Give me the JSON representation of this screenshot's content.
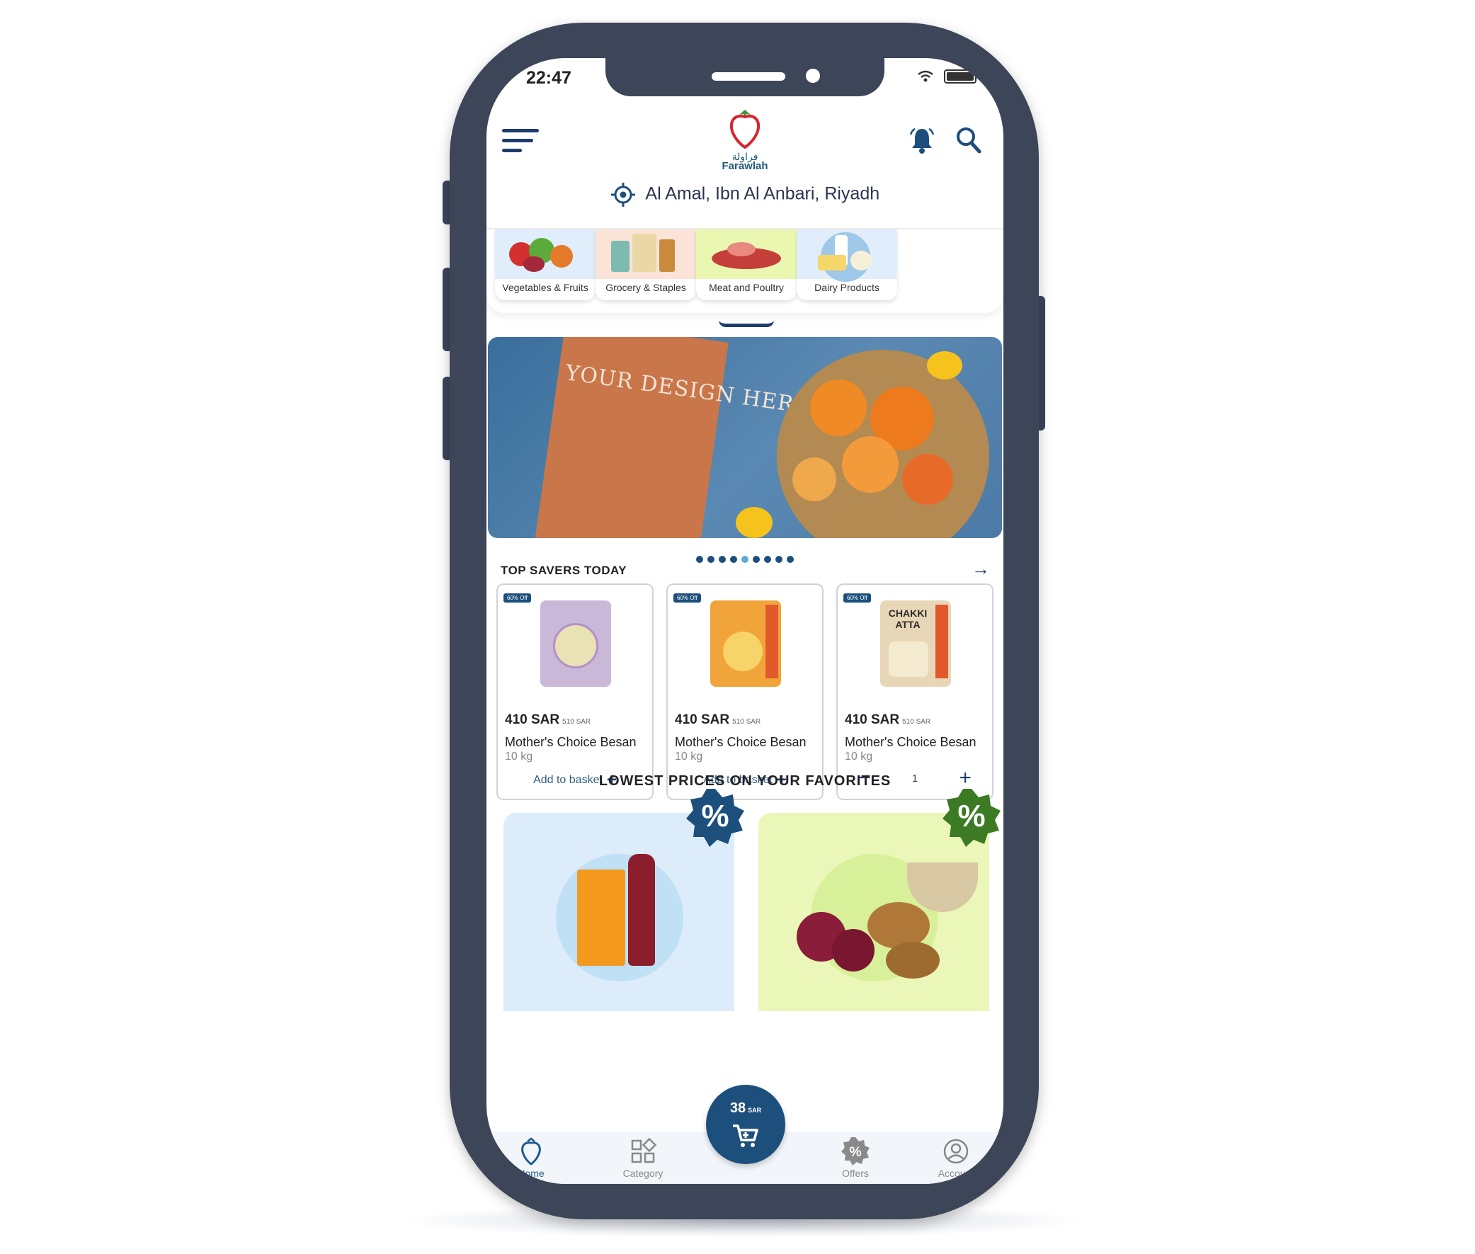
{
  "status_bar": {
    "time": "22:47",
    "icons": [
      "wifi-icon",
      "battery-icon"
    ]
  },
  "header": {
    "logo": {
      "arabic": "فراولة",
      "brand": "Farawlah"
    },
    "menu_icon": "hamburger-menu-icon",
    "bell_icon": "bell-icon",
    "search_icon": "search-icon",
    "location": "Al Amal, Ibn Al Anbari, Riyadh"
  },
  "categories": [
    {
      "label": "Vegetables & Fruits",
      "bg": "#dfeefa"
    },
    {
      "label": "Grocery & Staples",
      "bg": "#fbe3d8"
    },
    {
      "label": "Meat and Poultry",
      "bg": "#e9f7b0"
    },
    {
      "label": "Dairy Products",
      "bg": "#dfeefa"
    }
  ],
  "banner": {
    "card_text": "YOUR DESIGN HERE!",
    "slides": 10,
    "active_slide": 5
  },
  "top_savers": {
    "title": "TOP SAVERS TODAY",
    "products": [
      {
        "badge": "60% Off",
        "price": "410 SAR",
        "old_price": "510 SAR",
        "name": "Mother's Choice Besan",
        "weight": "10 kg",
        "action": "Add to basket",
        "pack_color": "#c9b8d8"
      },
      {
        "badge": "60% Off",
        "price": "410 SAR",
        "old_price": "510 SAR",
        "name": "Mother's Choice Besan",
        "weight": "10 kg",
        "action": "Add to basket",
        "pack_color": "#f1a43a"
      },
      {
        "badge": "60% Off",
        "price": "410 SAR",
        "old_price": "510 SAR",
        "name": "Mother's Choice Besan",
        "weight": "10 kg",
        "quantity": "1",
        "pack_color": "#e8d7b6",
        "pack_text": "CHAKKI ATTA"
      }
    ]
  },
  "favorites": {
    "title": "LOWEST PRICES ON YOUR FAVORITES",
    "cards": [
      {
        "bg": "#dcecfa",
        "circle": "#bfe0f5",
        "badge_color": "#1d4f7d",
        "badge_text": "%"
      },
      {
        "bg": "#eaf7b8",
        "circle": "#d8f09a",
        "badge_color": "#3c7a24",
        "badge_text": "%"
      }
    ]
  },
  "cart": {
    "amount": "38",
    "currency": "SAR"
  },
  "bottom_nav": [
    {
      "label": "Home",
      "active": true
    },
    {
      "label": "Category",
      "active": false
    },
    {
      "label": "Offers",
      "active": false
    },
    {
      "label": "Account",
      "active": false
    }
  ],
  "colors": {
    "primary": "#1d4f7d",
    "phone_frame": "#3d4559"
  }
}
